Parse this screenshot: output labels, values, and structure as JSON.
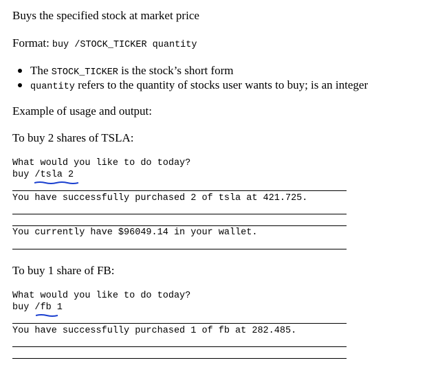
{
  "intro": "Buys the specified stock at market price",
  "format": {
    "label": "Format:",
    "code": "buy /STOCK_TICKER quantity"
  },
  "bullets": [
    {
      "code": "STOCK_TICKER",
      "prefix": "The ",
      "text": " is the stock’s short form"
    },
    {
      "code": "quantity",
      "prefix": "",
      "text": " refers to the quantity of stocks user wants to buy; is an integer"
    }
  ],
  "example_heading": "Example of usage and output:",
  "examples": [
    {
      "heading": "To buy 2 shares of TSLA:",
      "prompt": "What would you like to do today?",
      "command": "buy /tsla 2",
      "outputs": [
        "You have successfully purchased 2 of tsla at 421.725.",
        "",
        "You currently have $96049.14 in your wallet."
      ]
    },
    {
      "heading": "To buy 1 share of FB:",
      "prompt": "What would you like to do today?",
      "command": "buy /fb 1",
      "outputs": [
        "You have successfully purchased 1 of fb at 282.485.",
        ""
      ]
    }
  ],
  "colors": {
    "underline": "#1a3fcf",
    "text": "#000000",
    "rule": "#000000"
  }
}
